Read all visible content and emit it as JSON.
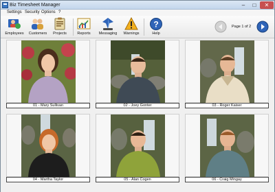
{
  "window": {
    "title": "Biz Timesheet Manager",
    "minimize": "–",
    "maximize": "□",
    "close": "✕"
  },
  "menu": {
    "items": [
      "Settings",
      "Security",
      "Options",
      "?"
    ]
  },
  "toolbar": {
    "buttons": [
      {
        "label": "Employees",
        "icon": "employees-icon"
      },
      {
        "label": "Customers",
        "icon": "customers-icon"
      },
      {
        "label": "Projects",
        "icon": "projects-icon"
      },
      {
        "label": "Reports",
        "icon": "reports-icon"
      },
      {
        "label": "Messaging",
        "icon": "messaging-icon"
      },
      {
        "label": "Warnings",
        "icon": "warnings-icon"
      },
      {
        "label": "Help",
        "icon": "help-icon"
      }
    ],
    "pager": {
      "label": "Page 1 of 2",
      "prev_icon": "previous-page-icon",
      "next_icon": "next-page-icon"
    }
  },
  "employees": [
    {
      "caption": "01 - Mary Sullivan"
    },
    {
      "caption": "02 - Joey Gonter"
    },
    {
      "caption": "03 - Roger Kaiser"
    },
    {
      "caption": "04 - Martha Taylor"
    },
    {
      "caption": "05 - Alan Cogen"
    },
    {
      "caption": "06 - Craig Mingay"
    }
  ],
  "colors": {
    "accent": "#1f5fa8",
    "close": "#c75050"
  }
}
